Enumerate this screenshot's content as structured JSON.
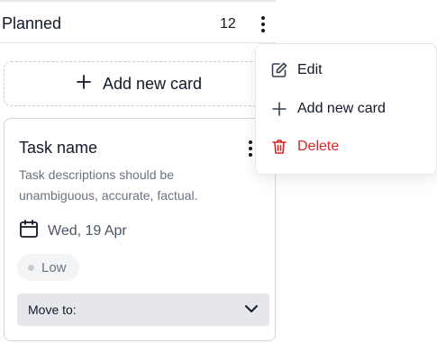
{
  "column": {
    "title": "Planned",
    "count": "12"
  },
  "add_card": {
    "label": "Add new card",
    "icon": "plus-icon"
  },
  "task": {
    "title": "Task name",
    "description": "Task descriptions should be unambiguous, accurate, factual.",
    "due_date": "Wed, 19 Apr",
    "priority": "Low",
    "move_label": "Move to:"
  },
  "menu": {
    "items": [
      {
        "label": "Edit",
        "icon": "edit-icon"
      },
      {
        "label": "Add new card",
        "icon": "plus-icon"
      },
      {
        "label": "Delete",
        "icon": "trash-icon"
      }
    ]
  },
  "colors": {
    "text": "#111827",
    "muted": "#6b7280",
    "danger": "#dc2626",
    "border": "#d1d5db",
    "select_bg": "#e5e7eb"
  }
}
